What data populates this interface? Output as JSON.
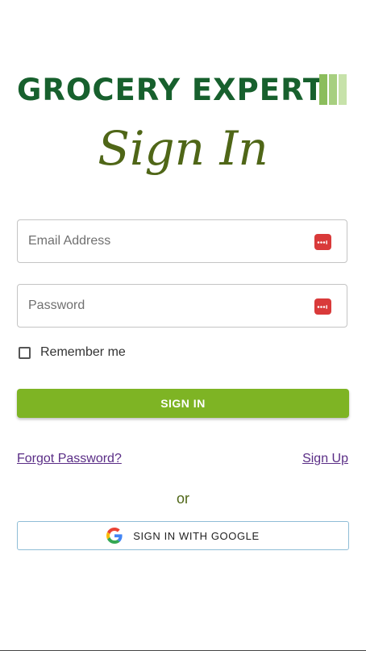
{
  "brand": {
    "name": "GROCERY EXPERT",
    "text_color": "#17602d",
    "bar_colors": [
      "#8bbd5c",
      "#a7cf80",
      "#c7e2aa"
    ]
  },
  "heading": "Sign In",
  "form": {
    "email_placeholder": "Email Address",
    "email_value": "",
    "password_placeholder": "Password",
    "password_value": "",
    "field_icon": "password-manager-icon",
    "remember_label": "Remember me",
    "remember_checked": false,
    "signin_label": "SIGN IN"
  },
  "links": {
    "forgot_password": "Forgot Password?",
    "sign_up": "Sign Up"
  },
  "divider_text": "or",
  "google": {
    "icon": "google-icon",
    "label": "SIGN IN WITH GOOGLE"
  },
  "colors": {
    "accent": "#7eb424",
    "heading": "#4f6617",
    "link": "#5a2d86",
    "field_icon": "#d93a3a"
  }
}
